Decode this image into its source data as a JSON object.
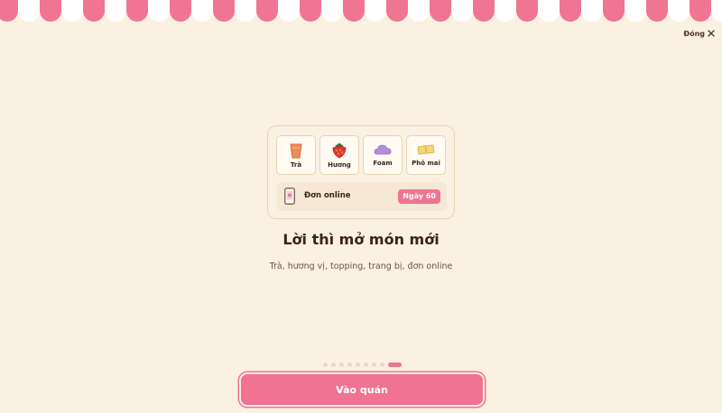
{
  "header": {
    "close_label": "Đóng"
  },
  "card": {
    "tiles": [
      {
        "label": "Trà",
        "icon": "tea-cup-icon"
      },
      {
        "label": "Hương",
        "icon": "strawberry-icon"
      },
      {
        "label": "Foam",
        "icon": "foam-cloud-icon"
      },
      {
        "label": "Phô mai",
        "icon": "cheese-icon"
      }
    ],
    "order": {
      "label": "Đơn online",
      "badge": "Ngày 60",
      "icon": "phone-icon"
    }
  },
  "title": "Lời thì mở món mới",
  "subtitle": "Trà, hương vị, topping, trang bị, đơn online",
  "pagination": {
    "total": 9,
    "current": 9
  },
  "primary_button": {
    "label": "Vào quán"
  },
  "colors": {
    "background": "#fbf1e2",
    "accent": "#f07392",
    "awning_pink": "#ef7593",
    "awning_white": "#ffffff"
  }
}
